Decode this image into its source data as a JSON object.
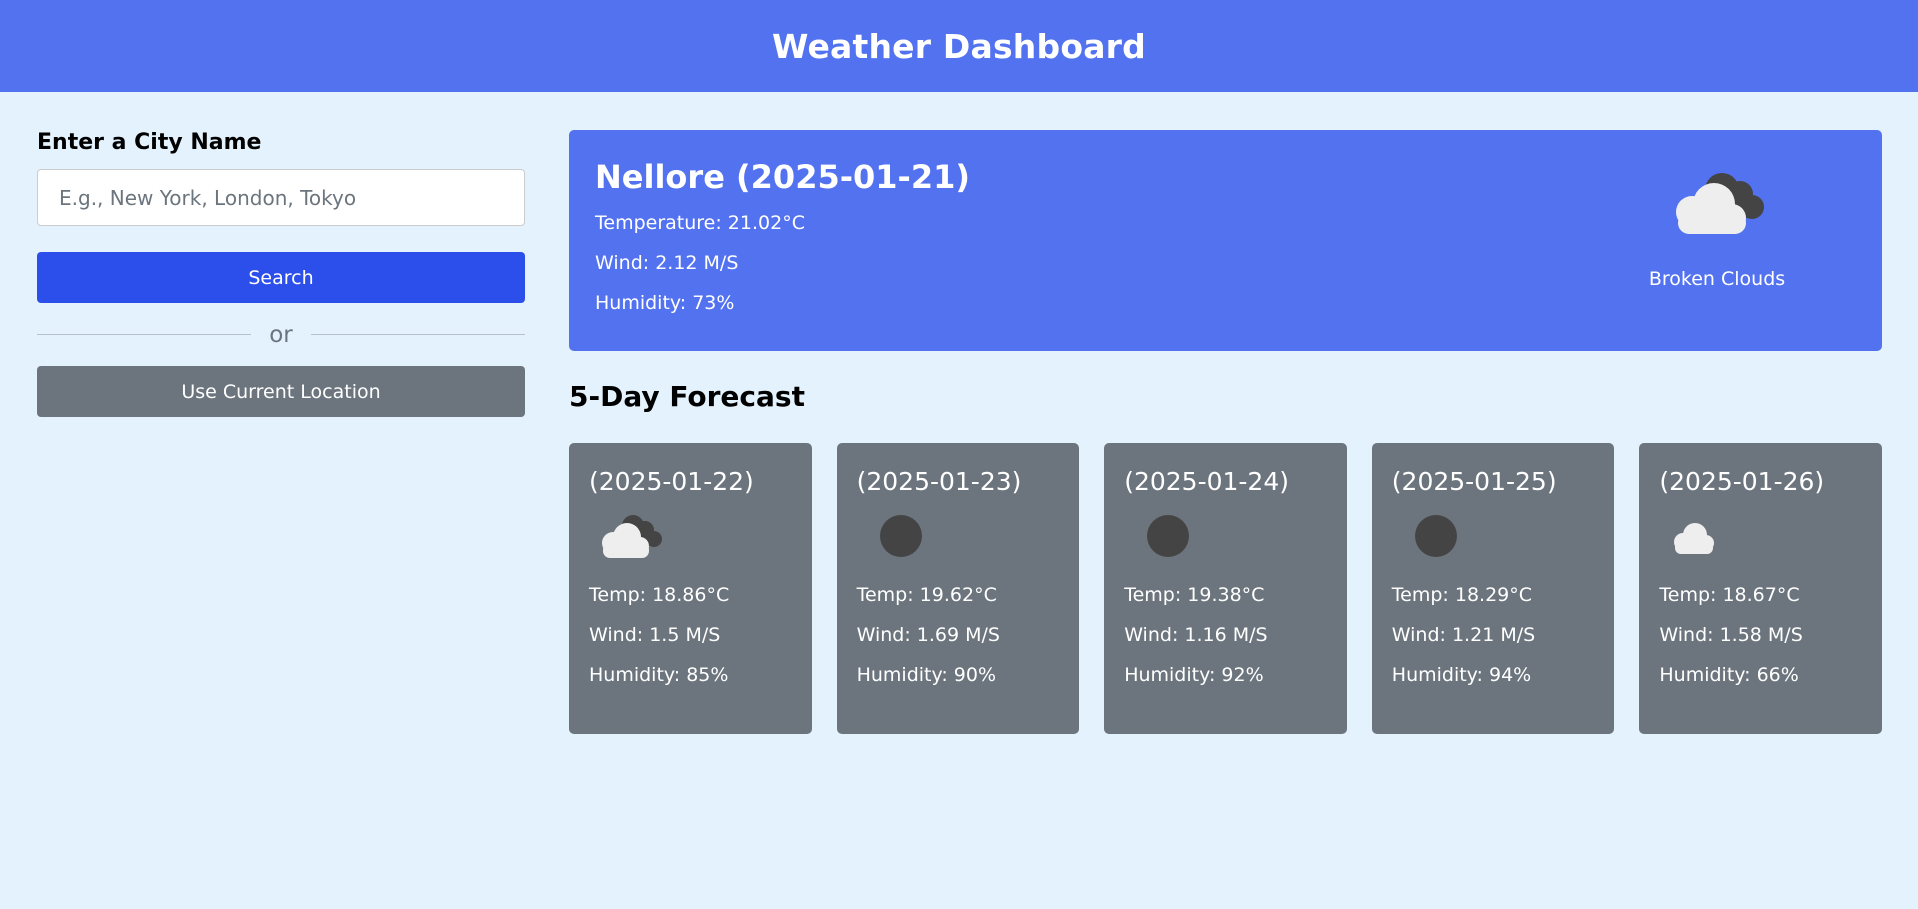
{
  "header": {
    "title": "Weather Dashboard"
  },
  "search": {
    "label": "Enter a City Name",
    "placeholder": "E.g., New York, London, Tokyo",
    "value": "",
    "search_button": "Search",
    "separator_text": "or",
    "location_button": "Use Current Location"
  },
  "current": {
    "title": "Nellore (2025-01-21)",
    "temperature": "Temperature: 21.02°C",
    "wind": "Wind: 2.12 M/S",
    "humidity": "Humidity: 73%",
    "icon": "broken-clouds-icon",
    "description": "Broken Clouds"
  },
  "forecast": {
    "title": "5-Day Forecast",
    "days": [
      {
        "date": "(2025-01-22)",
        "icon": "broken-clouds-icon",
        "temp": "Temp: 18.86°C",
        "wind": "Wind: 1.5 M/S",
        "humidity": "Humidity: 85%"
      },
      {
        "date": "(2025-01-23)",
        "icon": "dark-circle-icon",
        "temp": "Temp: 19.62°C",
        "wind": "Wind: 1.69 M/S",
        "humidity": "Humidity: 90%"
      },
      {
        "date": "(2025-01-24)",
        "icon": "dark-circle-icon",
        "temp": "Temp: 19.38°C",
        "wind": "Wind: 1.16 M/S",
        "humidity": "Humidity: 92%"
      },
      {
        "date": "(2025-01-25)",
        "icon": "dark-circle-icon",
        "temp": "Temp: 18.29°C",
        "wind": "Wind: 1.21 M/S",
        "humidity": "Humidity: 94%"
      },
      {
        "date": "(2025-01-26)",
        "icon": "cloud-icon",
        "temp": "Temp: 18.67°C",
        "wind": "Wind: 1.58 M/S",
        "humidity": "Humidity: 66%"
      }
    ]
  },
  "colors": {
    "accent": "#5372f0",
    "search_button": "#2c4fec",
    "card": "#6c757d",
    "background": "#e3f2fd"
  }
}
